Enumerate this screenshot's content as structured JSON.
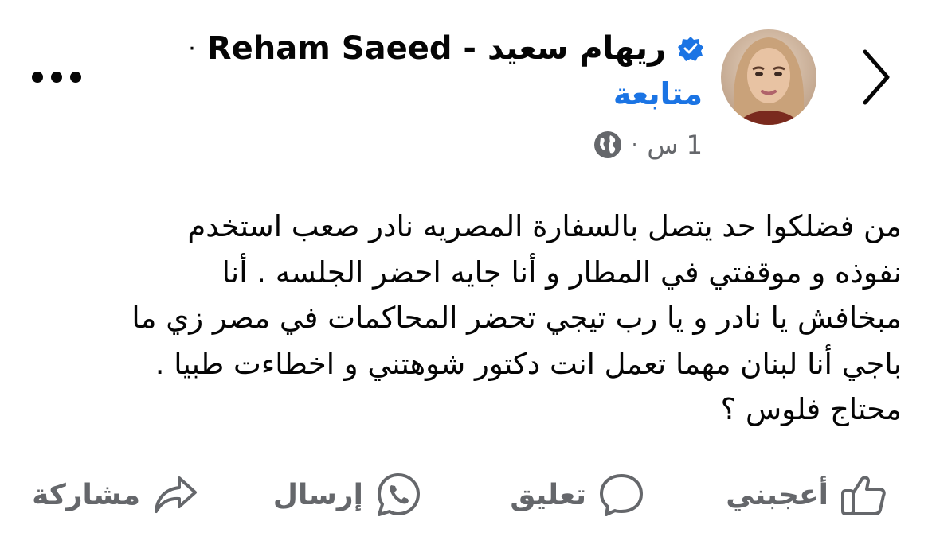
{
  "header": {
    "back_icon": "chevron-right-icon",
    "author_name": "ريهام  سعيد - Reham Saeed",
    "separator_dot": "·",
    "verified_icon": "verified-badge-icon",
    "follow_label": "متابعة",
    "time_label": "1 س",
    "meta_dot": "·",
    "privacy_icon": "globe-icon",
    "more_icon": "more-dots-icon"
  },
  "post": {
    "lines": [
      "من فضلكوا حد يتصل بالسفارة المصريه نادر صعب استخدم",
      "نفوذه و موقفتي في المطار و أنا جايه احضر الجلسه . أنا",
      "مبخافش يا نادر و يا رب تيجي تحضر المحاكمات  في مصر زي ما",
      "باجي أنا لبنان مهما تعمل انت دكتور شوهتني و اخطاءت طبيا .",
      "محتاج فلوس ؟"
    ]
  },
  "actions": {
    "like": {
      "label": "أعجبني",
      "icon": "thumbs-up-icon"
    },
    "comment": {
      "label": "تعليق",
      "icon": "comment-bubble-icon"
    },
    "send": {
      "label": "إرسال",
      "icon": "whatsapp-icon"
    },
    "share": {
      "label": "مشاركة",
      "icon": "share-arrow-icon"
    }
  },
  "colors": {
    "text": "#050505",
    "secondary": "#65676b",
    "accent": "#1b74e4"
  }
}
